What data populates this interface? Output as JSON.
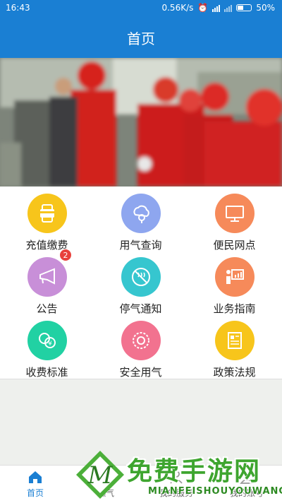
{
  "status": {
    "time": "16:43",
    "speed": "0.56K/s",
    "battery": "50%",
    "battery_level": 0.5
  },
  "header": {
    "title": "首页"
  },
  "grid": [
    {
      "label": "充值缴费",
      "icon": "credit-card-icon",
      "color": "#f7c51b"
    },
    {
      "label": "用气查询",
      "icon": "cloud-search-icon",
      "color": "#8ea6ef"
    },
    {
      "label": "便民网点",
      "icon": "monitor-icon",
      "color": "#f68a5a"
    },
    {
      "label": "公告",
      "icon": "megaphone-icon",
      "color": "#c88fd8",
      "badge": "2"
    },
    {
      "label": "停气通知",
      "icon": "no-gas-icon",
      "color": "#36c6cf"
    },
    {
      "label": "业务指南",
      "icon": "presentation-icon",
      "color": "#f68a5a"
    },
    {
      "label": "收费标准",
      "icon": "coins-icon",
      "color": "#21d1a3"
    },
    {
      "label": "安全用气",
      "icon": "safety-icon",
      "color": "#f2728f"
    },
    {
      "label": "政策法规",
      "icon": "document-icon",
      "color": "#f7c51b"
    }
  ],
  "tabbar": [
    {
      "label": "首页",
      "icon": "home-icon",
      "active": true
    },
    {
      "label": "燃气",
      "icon": "flame-icon"
    },
    {
      "label": "我的服务",
      "icon": "service-icon"
    },
    {
      "label": "我的账号",
      "icon": "account-icon"
    }
  ],
  "watermark": {
    "title": "免费手游网",
    "sub": "MIANFEISHOUYOUWANG",
    "mark": "M"
  },
  "colors": {
    "primary": "#1a7fd3",
    "badge": "#e8413c"
  }
}
